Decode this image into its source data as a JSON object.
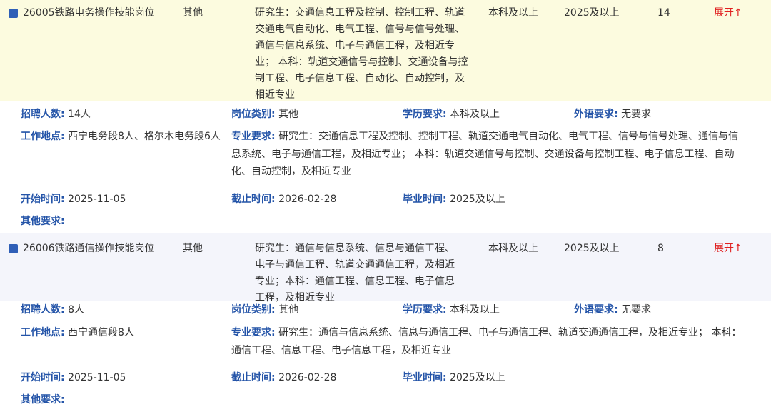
{
  "colors": {
    "accent": "#2454a8",
    "expand": "#e02020",
    "row1_bg": "#fcfbdf",
    "row2_bg": "#f4f5fb"
  },
  "labels": {
    "recruit": "招聘人数:",
    "category": "岗位类别:",
    "education": "学历要求:",
    "language": "外语要求:",
    "location": "工作地点:",
    "major": "专业要求:",
    "start": "开始时间:",
    "end": "截止时间:",
    "graduation": "毕业时间:",
    "other": "其他要求:"
  },
  "jobs": [
    {
      "name": "26005铁路电务操作技能岗位",
      "category": "其他",
      "major": "研究生：交通信息工程及控制、控制工程、轨道交通电气自动化、电气工程、信号与信号处理、通信与信息系统、电子与通信工程，及相近专业； 本科：轨道交通信号与控制、交通设备与控制工程、电子信息工程、自动化、自动控制，及相近专业",
      "education": "本科及以上",
      "graduation": "2025及以上",
      "count": "14",
      "expand": "展开↑",
      "detail": {
        "recruit": "14人",
        "category": "其他",
        "education": "本科及以上",
        "language": "无要求",
        "location": "西宁电务段8人、格尔木电务段6人",
        "major": "研究生：交通信息工程及控制、控制工程、轨道交通电气自动化、电气工程、信号与信号处理、通信与信息系统、电子与通信工程，及相近专业； 本科：轨道交通信号与控制、交通设备与控制工程、电子信息工程、自动化、自动控制，及相近专业",
        "start": "2025-11-05",
        "end": "2026-02-28",
        "graduation": "2025及以上",
        "other": ""
      }
    },
    {
      "name": "26006铁路通信操作技能岗位",
      "category": "其他",
      "major": "研究生：通信与信息系统、信息与通信工程、电子与通信工程、轨道交通通信工程，及相近专业；本科：通信工程、信息工程、电子信息工程，及相近专业",
      "education": "本科及以上",
      "graduation": "2025及以上",
      "count": "8",
      "expand": "展开↑",
      "detail": {
        "recruit": "8人",
        "category": "其他",
        "education": "本科及以上",
        "language": "无要求",
        "location": "西宁通信段8人",
        "major": "研究生：通信与信息系统、信息与通信工程、电子与通信工程、轨道交通通信工程，及相近专业； 本科：通信工程、信息工程、电子信息工程，及相近专业",
        "start": "2025-11-05",
        "end": "2026-02-28",
        "graduation": "2025及以上",
        "other": ""
      }
    }
  ]
}
